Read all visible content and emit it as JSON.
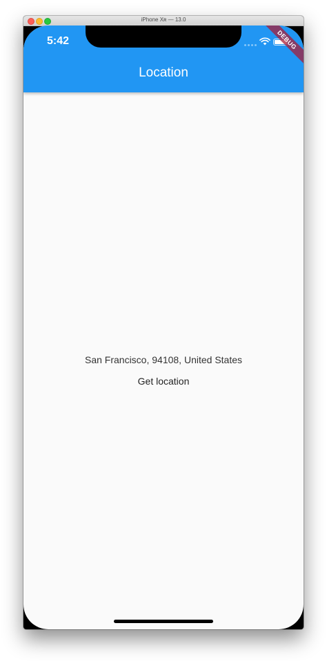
{
  "window": {
    "title": "iPhone Xʀ — 13.0"
  },
  "status_bar": {
    "time": "5:42",
    "icons": [
      "signal-dots-icon",
      "wifi-icon",
      "battery-icon"
    ]
  },
  "debug_banner": {
    "label": "DEBUG"
  },
  "app_bar": {
    "title": "Location",
    "color": "#2196f3"
  },
  "main": {
    "location_text": "San Francisco, 94108, United States",
    "get_location_label": "Get location"
  }
}
